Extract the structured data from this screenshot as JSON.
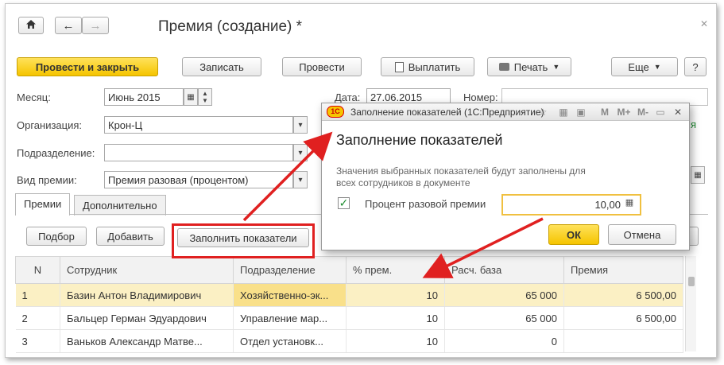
{
  "window": {
    "title": "Премия (создание) *"
  },
  "toolbar": {
    "post_and_close": "Провести и закрыть",
    "save": "Записать",
    "post": "Провести",
    "pay": "Выплатить",
    "print": "Печать",
    "more": "Еще",
    "help": "?"
  },
  "form": {
    "month_label": "Месяц:",
    "month_value": "Июнь 2015",
    "date_label": "Дата:",
    "date_value": "27.06.2015",
    "number_label": "Номер:",
    "number_value": "",
    "org_label": "Организация:",
    "org_value": "Крон-Ц",
    "dept_label": "Подразделение:",
    "dept_value": "",
    "bonus_type_label": "Вид премии:",
    "bonus_type_value": "Премия разовая (процентом)",
    "green_fragment": "я"
  },
  "tabs": [
    {
      "label": "Премии",
      "active": true
    },
    {
      "label": "Дополнительно",
      "active": false
    }
  ],
  "table_toolbar": {
    "select": "Подбор",
    "add": "Добавить",
    "fill": "Заполнить показатели"
  },
  "table": {
    "columns": [
      "N",
      "Сотрудник",
      "Подразделение",
      "% прем.",
      "Расч. база",
      "Премия"
    ],
    "rows": [
      {
        "n": "1",
        "employee": "Базин Антон Владимирович",
        "dept": "Хозяйственно-эк...",
        "pct": "10",
        "base": "65 000",
        "bonus": "6 500,00"
      },
      {
        "n": "2",
        "employee": "Бальцер Герман Эдуардович",
        "dept": "Управление мар...",
        "pct": "10",
        "base": "65 000",
        "bonus": "6 500,00"
      },
      {
        "n": "3",
        "employee": "Ваньков Александр Матве...",
        "dept": "Отдел установк...",
        "pct": "10",
        "base": "0",
        "bonus": ""
      }
    ]
  },
  "dialog": {
    "logo": "1С",
    "title": "Заполнение показателей (1С:Предприятие)",
    "header": "Заполнение показателей",
    "note": "Значения выбранных показателей будут заполнены для всех сотрудников в документе",
    "checkbox_label": "Процент разовой премии",
    "checkbox_checked": true,
    "value": "10,00",
    "ok": "ОК",
    "cancel": "Отмена",
    "title_icons": {
      "m": "M",
      "mplus": "M+",
      "mminus": "M-"
    }
  },
  "colors": {
    "accent_yellow": "#f5c400",
    "selection": "#fbf0c4",
    "arrow_red": "#e02020",
    "check_green": "#1d8c2f"
  }
}
